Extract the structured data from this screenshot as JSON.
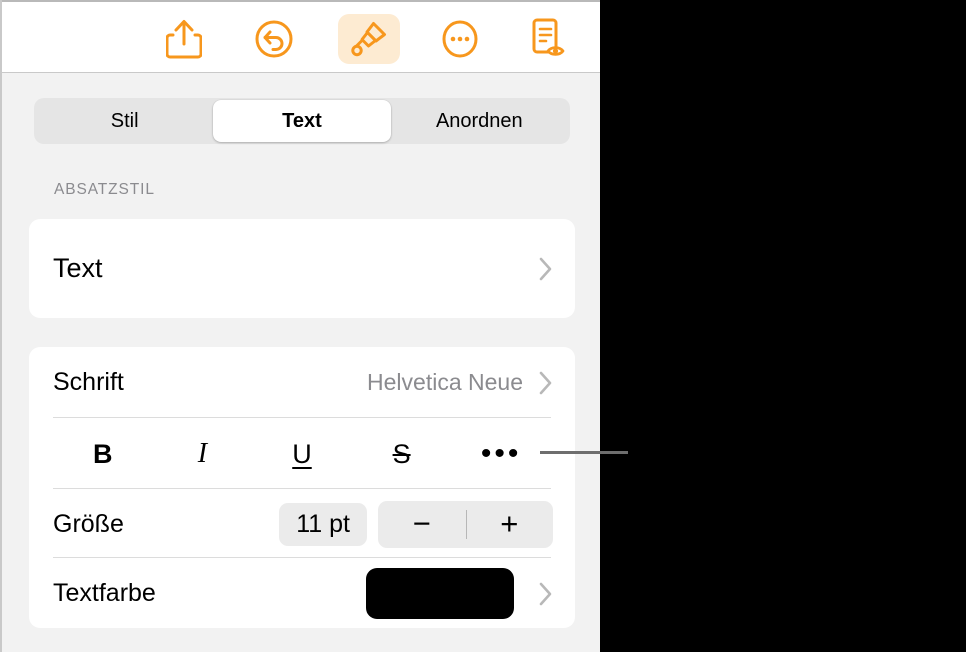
{
  "toolbar": {
    "buttons": [
      {
        "name": "share-icon",
        "label": "Teilen",
        "active": false
      },
      {
        "name": "undo-icon",
        "label": "Widerrufen",
        "active": false
      },
      {
        "name": "format-brush-icon",
        "label": "Format",
        "active": true
      },
      {
        "name": "more-options-icon",
        "label": "Mehr",
        "active": false
      },
      {
        "name": "document-view-icon",
        "label": "Dokument",
        "active": false
      }
    ]
  },
  "segmented_control": {
    "options": [
      "Stil",
      "Text",
      "Anordnen"
    ],
    "selected": "Text"
  },
  "sections": {
    "paragraph_style": {
      "header": "ABSATZSTIL",
      "value": "Text"
    },
    "font": {
      "font_label": "Schrift",
      "font_value": "Helvetica Neue",
      "format_buttons": [
        {
          "name": "bold-button",
          "label": "B"
        },
        {
          "name": "italic-button",
          "label": "I"
        },
        {
          "name": "underline-button",
          "label": "U"
        },
        {
          "name": "strikethrough-button",
          "label": "S"
        },
        {
          "name": "more-format-button",
          "label": "•••"
        }
      ],
      "size_label": "Größe",
      "size_value": "11 pt",
      "decrement_label": "−",
      "increment_label": "+",
      "color_label": "Textfarbe",
      "color_value": "#000000"
    }
  },
  "colors": {
    "accent": "#F7971D",
    "accent_tint": "#FDEBD2",
    "panel_bg": "#F2F2F2",
    "card_bg": "#FFFFFF",
    "track_bg": "#E5E5E5",
    "muted_text": "#8B8B8F",
    "callout_line": "#6E6E6E"
  }
}
